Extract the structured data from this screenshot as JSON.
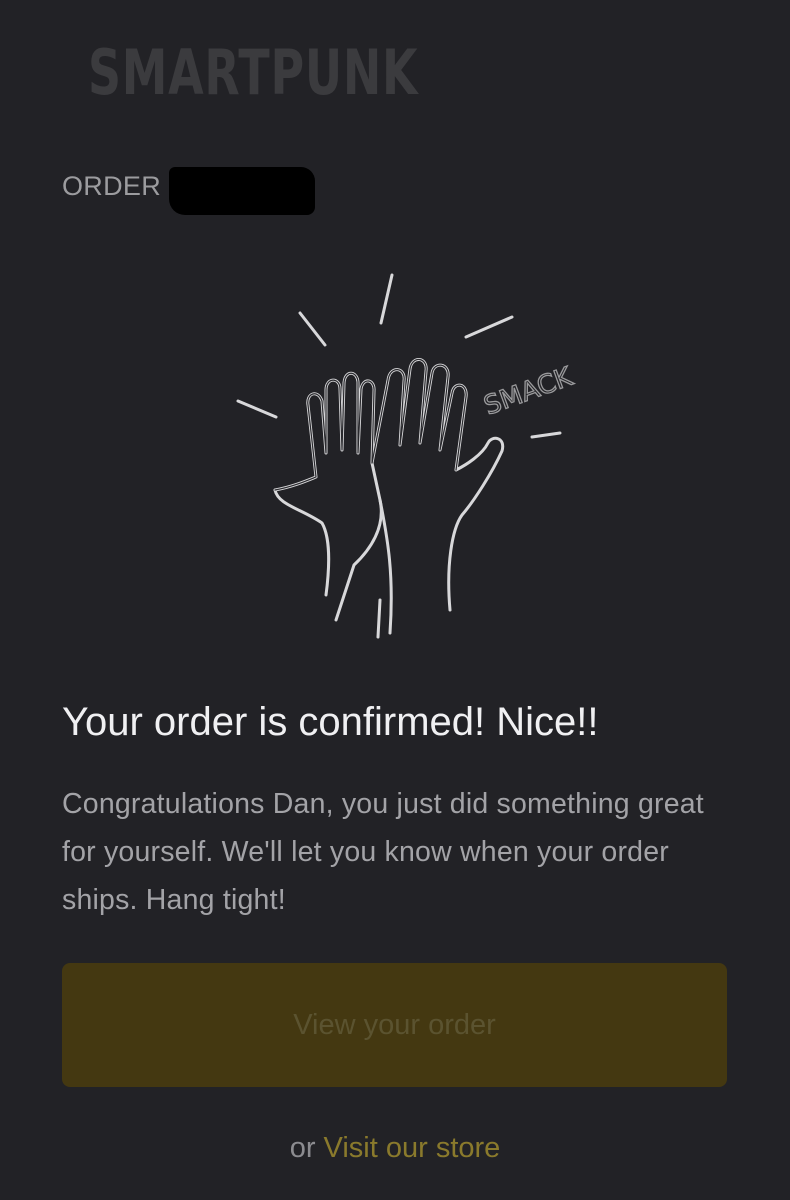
{
  "brand": {
    "name": "SMARTPUNK"
  },
  "order": {
    "label": "ORDER"
  },
  "illustration": {
    "icon": "high-five-icon",
    "sound_text": "SMACK"
  },
  "confirmation": {
    "headline": "Your order is confirmed! Nice!!",
    "message": "Congratulations Dan, you just did something great for yourself. We'll let you know when your order ships. Hang tight!"
  },
  "actions": {
    "view_order_label": "View your order",
    "or_text": "or",
    "visit_store_label": "Visit our store"
  },
  "colors": {
    "background": "#222226",
    "button": "#443811",
    "link": "#8a7a2c"
  }
}
